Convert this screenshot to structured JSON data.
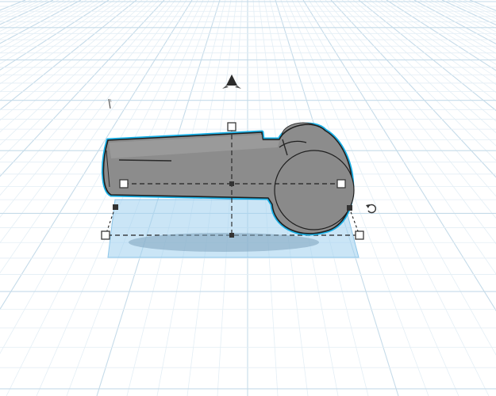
{
  "viewport": {
    "grid_color": "#c5dbe9",
    "grid_minor_color": "#e3eef5",
    "background": "#ffffff"
  },
  "selection": {
    "outline_color": "#1ab0e6",
    "footprint_fill": "#9fcfee",
    "handle_fill": "#ffffff",
    "handle_stroke": "#3a3a3a"
  },
  "shape": {
    "body_color": "#8c8c8c",
    "shade_color": "#7b7b7b",
    "highlight_color": "#a9a9a9"
  },
  "tools": {
    "lift_arrow_icon": "cone-arrow-up-icon",
    "rotate_icon": "rotate-arrow-icon",
    "cursor_icon": "mouse-cursor-icon"
  }
}
